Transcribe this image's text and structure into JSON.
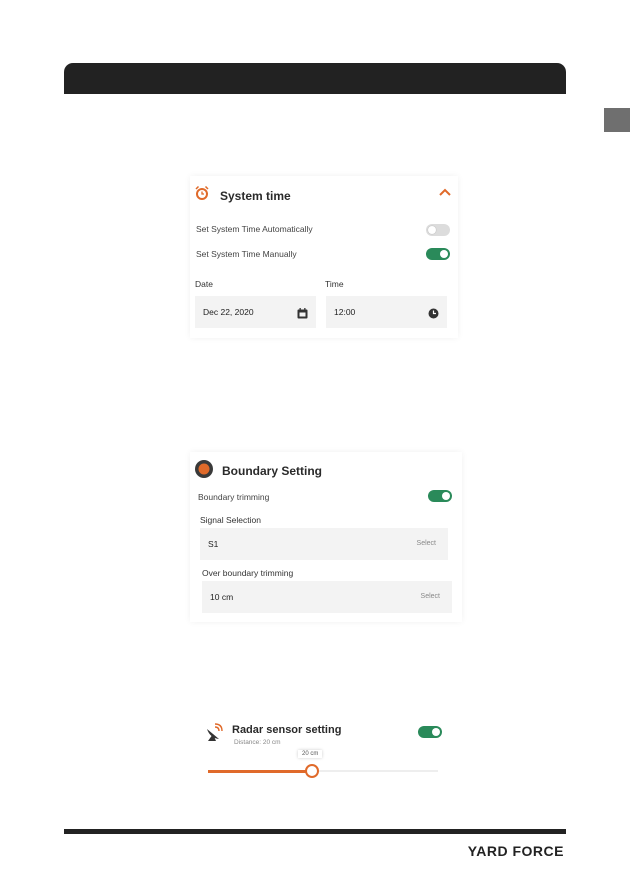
{
  "system_time": {
    "title": "System time",
    "auto_label": "Set System Time Automatically",
    "manual_label": "Set System Time  Manually",
    "auto_enabled": false,
    "manual_enabled": true,
    "date_label": "Date",
    "date_value": "Dec 22, 2020",
    "time_label": "Time",
    "time_value": "12:00",
    "icon": "alarm-clock-icon",
    "collapse_icon": "chevron-up-icon"
  },
  "boundary": {
    "title": "Boundary Setting",
    "trimming_label": "Boundary trimming",
    "trimming_enabled": true,
    "signal_label": "Signal Selection",
    "signal_value": "S1",
    "signal_select": "Select",
    "over_label": "Over boundary trimming",
    "over_value": "10 cm",
    "over_select": "Select",
    "icon": "record-dot-icon"
  },
  "radar": {
    "title": "Radar sensor setting",
    "subtitle": "Distance: 20 cm",
    "enabled": true,
    "slider_tooltip": "20 cm",
    "slider_fraction": 0.45,
    "icon": "satellite-dish-icon"
  },
  "footer": {
    "brand": "YARD FORCE"
  },
  "colors": {
    "accent": "#e06a2a",
    "toggle_on": "#2a8a5a",
    "toggle_off": "#dcdcdc",
    "bar": "#222222"
  }
}
